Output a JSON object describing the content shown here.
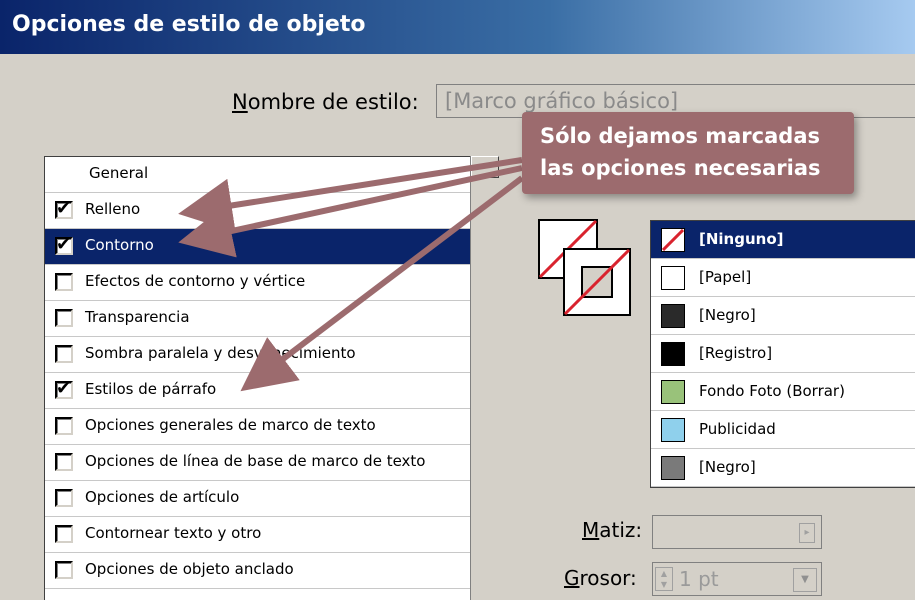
{
  "dialog": {
    "title": "Opciones de estilo de objeto"
  },
  "style_name": {
    "label_prefix": "N",
    "label_rest": "ombre de estilo:",
    "value": "[Marco gráfico básico]"
  },
  "categories": {
    "header": "General",
    "items": [
      {
        "label": "Relleno",
        "checked": true,
        "selected": false
      },
      {
        "label": "Contorno",
        "checked": true,
        "selected": true
      },
      {
        "label": "Efectos de contorno y vértice",
        "checked": false,
        "selected": false
      },
      {
        "label": "Transparencia",
        "checked": false,
        "selected": false
      },
      {
        "label": "Sombra paralela y desvanecimiento",
        "checked": false,
        "selected": false
      },
      {
        "label": "Estilos de párrafo",
        "checked": true,
        "selected": false
      },
      {
        "label": "Opciones generales de marco de texto",
        "checked": false,
        "selected": false
      },
      {
        "label": "Opciones de línea de base de marco de texto",
        "checked": false,
        "selected": false
      },
      {
        "label": "Opciones de artículo",
        "checked": false,
        "selected": false
      },
      {
        "label": "Contornear texto y otro",
        "checked": false,
        "selected": false
      },
      {
        "label": "Opciones de objeto anclado",
        "checked": false,
        "selected": false
      }
    ]
  },
  "swatches": {
    "items": [
      {
        "name": "[Ninguno]",
        "color": "none",
        "selected": true
      },
      {
        "name": "[Papel]",
        "color": "#ffffff",
        "selected": false
      },
      {
        "name": "[Negro]",
        "color": "#2a2a2a",
        "selected": false
      },
      {
        "name": "[Registro]",
        "color": "#000000",
        "selected": false
      },
      {
        "name": "Fondo Foto (Borrar)",
        "color": "#99c27a",
        "selected": false
      },
      {
        "name": "Publicidad",
        "color": "#8fd0ec",
        "selected": false
      },
      {
        "name": "[Negro]",
        "color": "#7a7a7a",
        "selected": false
      }
    ]
  },
  "tint": {
    "label_prefix": "M",
    "label_rest": "atiz:",
    "value": ""
  },
  "weight": {
    "label_prefix": "G",
    "label_rest": "rosor:",
    "value": "1 pt"
  },
  "callout": {
    "line1": "Sólo dejamos marcadas",
    "line2": "las opciones necesarias",
    "color": "#9c6b6e"
  },
  "colors": {
    "selection": "#0a246a",
    "dialog_bg": "#d4d0c8"
  }
}
